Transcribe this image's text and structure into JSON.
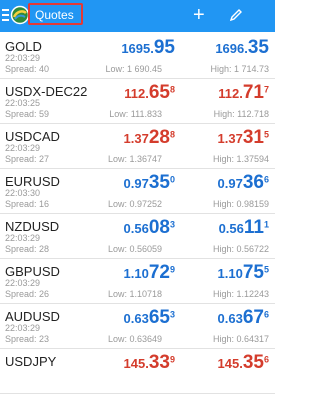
{
  "header": {
    "title": "Quotes",
    "accent_color": "#2196f3",
    "icons": [
      "menu-icon",
      "app-logo-icon",
      "add-icon",
      "edit-icon"
    ]
  },
  "quotes": [
    {
      "symbol": "GOLD",
      "time": "22:03:29",
      "spread": "Spread: 40",
      "bid_main": "1695.",
      "bid_big": "95",
      "bid_sup": "",
      "ask_main": "1696.",
      "ask_big": "35",
      "ask_sup": "",
      "low": "Low: 1 690.45",
      "high": "High: 1 714.73",
      "color": "blue"
    },
    {
      "symbol": "USDX-DEC22",
      "time": "22:03:25",
      "spread": "Spread: 59",
      "bid_main": "112.",
      "bid_big": "65",
      "bid_sup": "8",
      "ask_main": "112.",
      "ask_big": "71",
      "ask_sup": "7",
      "low": "Low: 111.833",
      "high": "High: 112.718",
      "color": "red"
    },
    {
      "symbol": "USDCAD",
      "time": "22:03:29",
      "spread": "Spread: 27",
      "bid_main": "1.37",
      "bid_big": "28",
      "bid_sup": "8",
      "ask_main": "1.37",
      "ask_big": "31",
      "ask_sup": "5",
      "low": "Low: 1.36747",
      "high": "High: 1.37594",
      "color": "red"
    },
    {
      "symbol": "EURUSD",
      "time": "22:03:30",
      "spread": "Spread: 16",
      "bid_main": "0.97",
      "bid_big": "35",
      "bid_sup": "0",
      "ask_main": "0.97",
      "ask_big": "36",
      "ask_sup": "6",
      "low": "Low: 0.97252",
      "high": "High: 0.98159",
      "color": "blue"
    },
    {
      "symbol": "NZDUSD",
      "time": "22:03:29",
      "spread": "Spread: 28",
      "bid_main": "0.56",
      "bid_big": "08",
      "bid_sup": "3",
      "ask_main": "0.56",
      "ask_big": "11",
      "ask_sup": "1",
      "low": "Low: 0.56059",
      "high": "High: 0.56722",
      "color": "blue"
    },
    {
      "symbol": "GBPUSD",
      "time": "22:03:29",
      "spread": "Spread: 26",
      "bid_main": "1.10",
      "bid_big": "72",
      "bid_sup": "9",
      "ask_main": "1.10",
      "ask_big": "75",
      "ask_sup": "5",
      "low": "Low: 1.10718",
      "high": "High: 1.12243",
      "color": "blue"
    },
    {
      "symbol": "AUDUSD",
      "time": "22:03:29",
      "spread": "Spread: 23",
      "bid_main": "0.63",
      "bid_big": "65",
      "bid_sup": "3",
      "ask_main": "0.63",
      "ask_big": "67",
      "ask_sup": "6",
      "low": "Low: 0.63649",
      "high": "High: 0.64317",
      "color": "blue"
    },
    {
      "symbol": "USDJPY",
      "time": "",
      "spread": "",
      "bid_main": "145.",
      "bid_big": "33",
      "bid_sup": "9",
      "ask_main": "145.",
      "ask_big": "35",
      "ask_sup": "6",
      "low": "",
      "high": "",
      "color": "red"
    }
  ]
}
